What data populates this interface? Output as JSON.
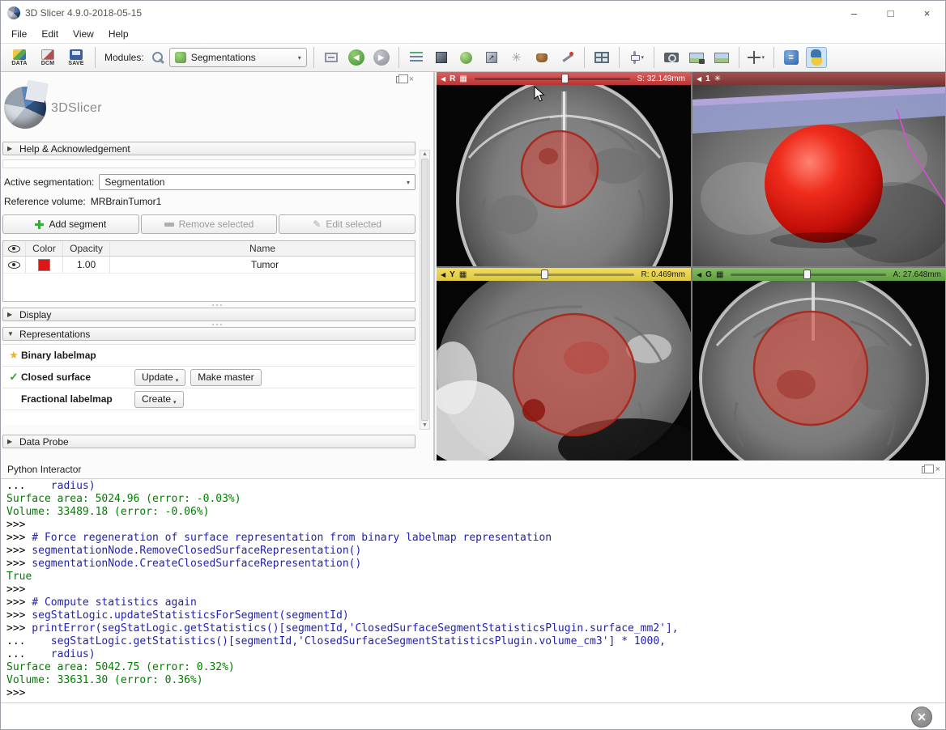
{
  "window": {
    "title": "3D Slicer 4.9.0-2018-05-15",
    "minimize": "–",
    "maximize": "□",
    "close": "×"
  },
  "menu": {
    "items": [
      "File",
      "Edit",
      "View",
      "Help"
    ]
  },
  "toolbar": {
    "data": "DATA",
    "dcm": "DCM",
    "save": "SAVE",
    "modules_label": "Modules:",
    "module_selected": "Segmentations",
    "combo_arrow": "▾",
    "back_glyph": "◀",
    "forward_glyph": "▶"
  },
  "panel": {
    "logo": "3DSlicer",
    "help_section": "Help & Acknowledgement",
    "active_label": "Active segmentation:",
    "active_value": "Segmentation",
    "reference_label": "Reference volume:",
    "reference_value": "MRBrainTumor1",
    "add_segment": "Add segment",
    "remove_selected": "Remove selected",
    "edit_selected": "Edit selected",
    "table": {
      "col_color": "Color",
      "col_opacity": "Opacity",
      "col_name": "Name",
      "row": {
        "opacity": "1.00",
        "name": "Tumor",
        "color": "#e01717"
      }
    },
    "display_section": "Display",
    "representations_section": "Representations",
    "rep_binary": "Binary labelmap",
    "rep_closed": "Closed surface",
    "rep_fractional": "Fractional labelmap",
    "update_btn": "Update",
    "make_master_btn": "Make master",
    "create_btn": "Create",
    "data_probe_section": "Data Probe"
  },
  "views": {
    "red": {
      "label": "R",
      "offset": "S: 32.149mm"
    },
    "view3d": {
      "label": "1"
    },
    "yellow": {
      "label": "Y",
      "offset": "R: 0.469mm"
    },
    "green": {
      "label": "G",
      "offset": "A: 27.648mm"
    }
  },
  "colors": {
    "red_bar": "#c64545",
    "threeD_bar": "#8e4040",
    "yellow_bar": "#e6d44f",
    "green_bar": "#6fae4e",
    "segment": "#e01717",
    "console_command": "#2222b2",
    "console_output": "#007d00"
  },
  "python": {
    "title": "Python Interactor",
    "lines": [
      {
        "prompt": "...",
        "code": "    radius)",
        "type": "cmd"
      },
      {
        "prompt": "",
        "code": "Surface area: 5024.96 (error: -0.03%)",
        "type": "out"
      },
      {
        "prompt": "",
        "code": "Volume: 33489.18 (error: -0.06%)",
        "type": "out"
      },
      {
        "prompt": ">>>",
        "code": "",
        "type": "cmd"
      },
      {
        "prompt": ">>>",
        "code": " # Force regeneration of surface representation from binary labelmap representation",
        "type": "cmd"
      },
      {
        "prompt": ">>>",
        "code": " segmentationNode.RemoveClosedSurfaceRepresentation()",
        "type": "cmd"
      },
      {
        "prompt": ">>>",
        "code": " segmentationNode.CreateClosedSurfaceRepresentation()",
        "type": "cmd"
      },
      {
        "prompt": "",
        "code": "True",
        "type": "out"
      },
      {
        "prompt": ">>>",
        "code": "",
        "type": "cmd"
      },
      {
        "prompt": ">>>",
        "code": " # Compute statistics again",
        "type": "cmd"
      },
      {
        "prompt": ">>>",
        "code": " segStatLogic.updateStatisticsForSegment(segmentId)",
        "type": "cmd"
      },
      {
        "prompt": ">>>",
        "code": " printError(segStatLogic.getStatistics()[segmentId,'ClosedSurfaceSegmentStatisticsPlugin.surface_mm2'],",
        "type": "cmd"
      },
      {
        "prompt": "...",
        "code": "    segStatLogic.getStatistics()[segmentId,'ClosedSurfaceSegmentStatisticsPlugin.volume_cm3'] * 1000,",
        "type": "cmd"
      },
      {
        "prompt": "...",
        "code": "    radius)",
        "type": "cmd"
      },
      {
        "prompt": "",
        "code": "Surface area: 5042.75 (error: 0.32%)",
        "type": "out"
      },
      {
        "prompt": "",
        "code": "Volume: 33631.30 (error: 0.36%)",
        "type": "out"
      },
      {
        "prompt": ">>>",
        "code": "",
        "type": "cmd"
      }
    ]
  }
}
